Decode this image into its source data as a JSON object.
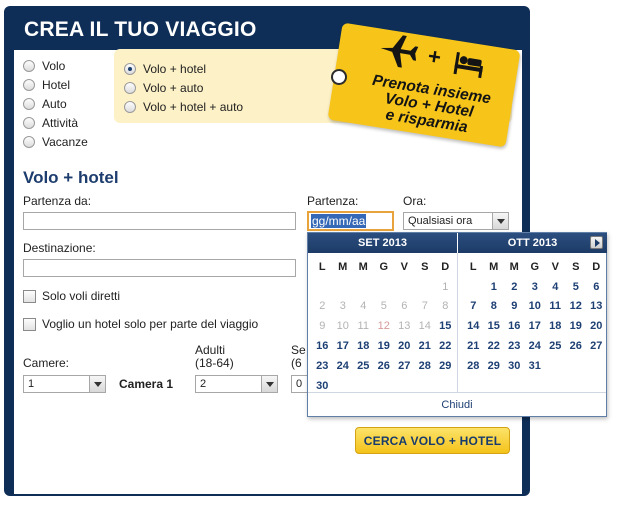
{
  "header": {
    "title": "CREA IL TUO VIAGGIO"
  },
  "product_types": [
    {
      "label": "Volo",
      "selected": false
    },
    {
      "label": "Hotel",
      "selected": false
    },
    {
      "label": "Auto",
      "selected": false
    },
    {
      "label": "Attività",
      "selected": false
    },
    {
      "label": "Vacanze",
      "selected": false
    }
  ],
  "package_types": [
    {
      "label": "Volo + hotel",
      "selected": true
    },
    {
      "label": "Volo + auto",
      "selected": false
    },
    {
      "label": "Volo + hotel + auto",
      "selected": false
    }
  ],
  "promo": {
    "plus_sign": "+",
    "text_line1": "Prenota insieme",
    "text_line2": "Volo + Hotel",
    "text_line3": "e risparmia",
    "icons": [
      "airplane-icon",
      "bed-icon"
    ],
    "color": "#f7c51a"
  },
  "form": {
    "section_title": "Volo + hotel",
    "from_label": "Partenza da:",
    "from_value": "",
    "destination_label": "Destinazione:",
    "destination_value": "",
    "departure_label": "Partenza:",
    "departure_placeholder": "gg/mm/aa",
    "time_label": "Ora:",
    "time_value": "Qualsiasi ora",
    "direct_flights_label": "Solo voli diretti",
    "partial_hotel_label": "Voglio un hotel solo per parte del viaggio",
    "rooms_label": "Camere:",
    "rooms_value": "1",
    "room_label": "Camera 1",
    "adults_label_line1": "Adulti",
    "adults_label_line2": "(18-64)",
    "adults_value": "2",
    "seniors_label_line1": "Se",
    "seniors_label_line2": "(6",
    "seniors_value": "0",
    "submit_label": "CERCA VOLO + HOTEL"
  },
  "calendar": {
    "weekdays": [
      "L",
      "M",
      "M",
      "G",
      "V",
      "S",
      "D"
    ],
    "left": {
      "title": "SET 2013",
      "cells": [
        "",
        "",
        "",
        "",
        "",
        "",
        "1",
        "2",
        "3",
        "4",
        "5",
        "6",
        "7",
        "8",
        "9",
        "10",
        "11",
        "12",
        "13",
        "14",
        "15",
        "16",
        "17",
        "18",
        "19",
        "20",
        "21",
        "22",
        "23",
        "24",
        "25",
        "26",
        "27",
        "28",
        "29",
        "30",
        "",
        "",
        "",
        "",
        "",
        ""
      ],
      "past_through": 14,
      "today": 12
    },
    "right": {
      "title": "OTT 2013",
      "cells": [
        "",
        "1",
        "2",
        "3",
        "4",
        "5",
        "6",
        "7",
        "8",
        "9",
        "10",
        "11",
        "12",
        "13",
        "14",
        "15",
        "16",
        "17",
        "18",
        "19",
        "20",
        "21",
        "22",
        "23",
        "24",
        "25",
        "26",
        "27",
        "28",
        "29",
        "30",
        "31",
        "",
        "",
        ""
      ]
    },
    "close_label": "Chiudi"
  },
  "colors": {
    "frame": "#0f2e57",
    "accent_blue": "#1d3d6e",
    "promo_bg": "#fdf1c7",
    "button_yellow": "#f4c21a"
  }
}
